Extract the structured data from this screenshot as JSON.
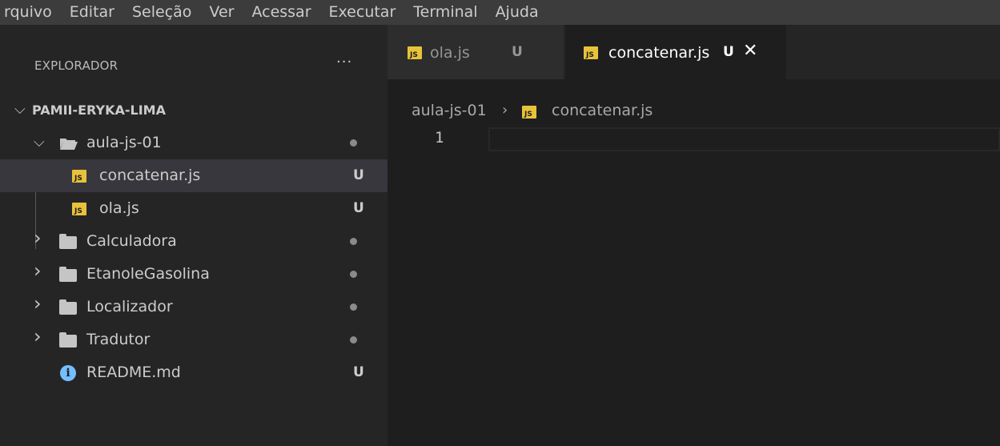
{
  "menubar": {
    "items": [
      "rquivo",
      "Editar",
      "Seleção",
      "Ver",
      "Acessar",
      "Executar",
      "Terminal",
      "Ajuda"
    ]
  },
  "sidebar": {
    "title": "EXPLORADOR",
    "more": "···",
    "root": "PAMII-ERYKA-LIMA",
    "tree": [
      {
        "label": "aula-js-01",
        "kind": "folder-open",
        "status": "dot"
      },
      {
        "label": "concatenar.js",
        "kind": "js-file",
        "status": "U",
        "selected": true
      },
      {
        "label": "ola.js",
        "kind": "js-file",
        "status": "U"
      },
      {
        "label": "Calculadora",
        "kind": "folder",
        "status": "dot"
      },
      {
        "label": "EtanoleGasolina",
        "kind": "folder",
        "status": "dot"
      },
      {
        "label": "Localizador",
        "kind": "folder",
        "status": "dot"
      },
      {
        "label": "Tradutor",
        "kind": "folder",
        "status": "dot"
      },
      {
        "label": "README.md",
        "kind": "info-file",
        "status": "U"
      }
    ]
  },
  "tabs": [
    {
      "label": "ola.js",
      "status": "U",
      "active": false
    },
    {
      "label": "concatenar.js",
      "status": "U",
      "active": true,
      "close": "✕"
    }
  ],
  "breadcrumb": {
    "folder": "aula-js-01",
    "separator": "›",
    "file": "concatenar.js"
  },
  "editor": {
    "line_numbers": [
      "1"
    ]
  },
  "icons": {
    "js": "JS",
    "info": "i",
    "chevron_down": "⌵",
    "chevron_right": "›"
  },
  "colors": {
    "js_icon": "#e8c33a",
    "info_icon": "#75beff",
    "selected_row": "#37373d"
  }
}
